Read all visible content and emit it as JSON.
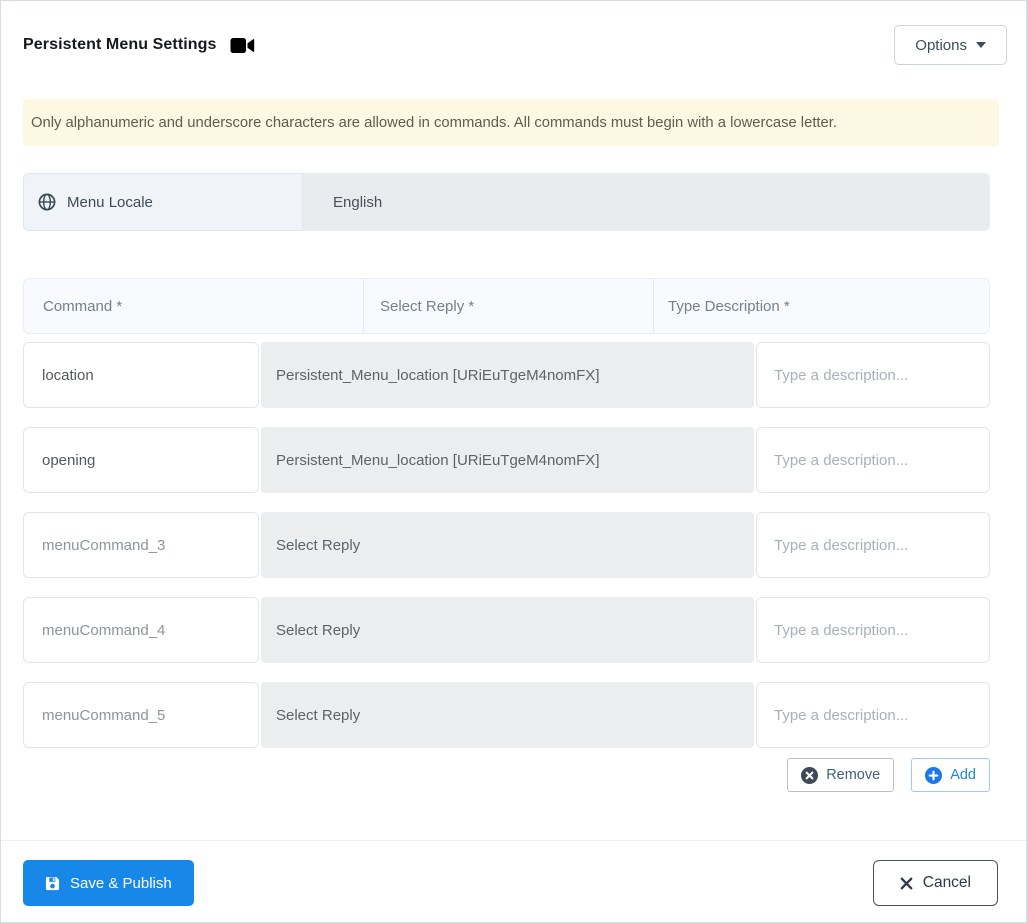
{
  "header": {
    "title": "Persistent Menu Settings",
    "options_label": "Options"
  },
  "banner": {
    "text": "Only alphanumeric and underscore characters are allowed in commands. All commands must begin with a lowercase letter."
  },
  "locale": {
    "label": "Menu Locale",
    "value": "English"
  },
  "table": {
    "headers": [
      "Command *",
      "Select Reply *",
      "Type Description *"
    ],
    "rows": [
      {
        "command_value": "location",
        "command_placeholder": "",
        "reply": "Persistent_Menu_location [URiEuTgeM4nomFX]",
        "description_value": "",
        "description_placeholder": "Type a description..."
      },
      {
        "command_value": "opening",
        "command_placeholder": "",
        "reply": "Persistent_Menu_location [URiEuTgeM4nomFX]",
        "description_value": "",
        "description_placeholder": "Type a description..."
      },
      {
        "command_value": "",
        "command_placeholder": "menuCommand_3",
        "reply": "Select Reply",
        "description_value": "",
        "description_placeholder": "Type a description..."
      },
      {
        "command_value": "",
        "command_placeholder": "menuCommand_4",
        "reply": "Select Reply",
        "description_value": "",
        "description_placeholder": "Type a description..."
      },
      {
        "command_value": "",
        "command_placeholder": "menuCommand_5",
        "reply": "Select Reply",
        "description_value": "",
        "description_placeholder": "Type a description..."
      }
    ]
  },
  "row_actions": {
    "remove_label": "Remove",
    "add_label": "Add"
  },
  "footer": {
    "save_label": "Save & Publish",
    "cancel_label": "Cancel"
  },
  "icons": {
    "title_icon": "video-camera-icon",
    "options_icon": "caret-down-icon",
    "locale_icon": "globe-icon",
    "remove_icon": "circle-x-icon",
    "add_icon": "circle-plus-icon",
    "save_icon": "floppy-disk-icon",
    "cancel_icon": "x-icon"
  },
  "colors": {
    "primary_blue": "#1787e8",
    "add_accent": "#1b87e5",
    "banner_bg": "#fdf8e2",
    "select_bg": "#ebedee",
    "table_header_bg": "#f8fafd",
    "locale_label_bg": "#f0f3f7",
    "locale_value_bg": "#e9ecef",
    "dark_slate": "#3e4a57"
  }
}
